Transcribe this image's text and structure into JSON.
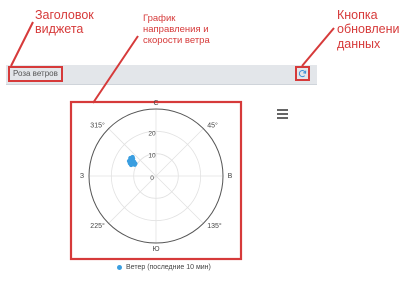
{
  "annotations": {
    "widget_title": [
      "Заголовок",
      "виджета"
    ],
    "chart": [
      "График",
      "направления и",
      "скорости ветра"
    ],
    "refresh": [
      "Кнопка",
      "обновления",
      "данных"
    ]
  },
  "widget": {
    "title": "Роза ветров",
    "refresh_icon": "refresh-icon",
    "menu_icon": "hamburger-menu-icon"
  },
  "colors": {
    "annotation": "#d63a3a",
    "header_bg": "#e3e6ea",
    "series": "#3a9ee0",
    "refresh_icon": "#3a8fd6"
  },
  "chart_data": {
    "type": "scatter",
    "coordinate_system": "polar",
    "directions": {
      "n": "С",
      "e": "В",
      "s": "Ю",
      "w": "З"
    },
    "angle_labels": [
      "45°",
      "135°",
      "225°",
      "315°"
    ],
    "radial_ticks": [
      0,
      10,
      20
    ],
    "radial_max": 30,
    "series": [
      {
        "name": "Ветер (последние 10 мин)",
        "color": "#3a9ee0",
        "points": [
          {
            "direction_deg": 301,
            "speed": 12.7
          },
          {
            "direction_deg": 302,
            "speed": 12.4
          },
          {
            "direction_deg": 304,
            "speed": 12.9
          },
          {
            "direction_deg": 303,
            "speed": 13.3
          },
          {
            "direction_deg": 298,
            "speed": 12.3
          },
          {
            "direction_deg": 296,
            "speed": 11.9
          },
          {
            "direction_deg": 300,
            "speed": 11.5
          },
          {
            "direction_deg": 307,
            "speed": 12.9
          },
          {
            "direction_deg": 309,
            "speed": 13.5
          },
          {
            "direction_deg": 305,
            "speed": 14.0
          },
          {
            "direction_deg": 299,
            "speed": 13.8
          },
          {
            "direction_deg": 294,
            "speed": 12.2
          },
          {
            "direction_deg": 303,
            "speed": 11.7
          },
          {
            "direction_deg": 296,
            "speed": 13.0
          },
          {
            "direction_deg": 298,
            "speed": 10.8
          },
          {
            "direction_deg": 301,
            "speed": 10.8
          }
        ]
      }
    ]
  }
}
